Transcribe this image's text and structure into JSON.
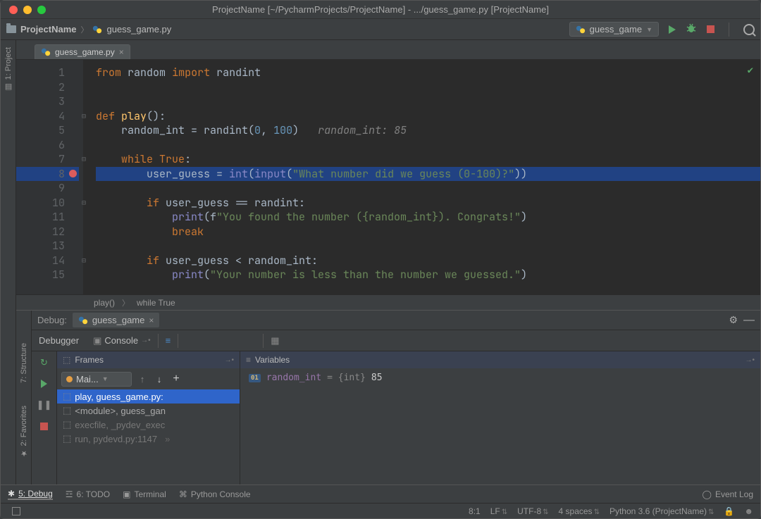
{
  "window": {
    "title": "ProjectName [~/PycharmProjects/ProjectName] - .../guess_game.py [ProjectName]"
  },
  "breadcrumb": {
    "project": "ProjectName",
    "file": "guess_game.py"
  },
  "run_config": {
    "label": "guess_game"
  },
  "left_tools": {
    "project": "1: Project",
    "structure": "7: Structure",
    "favorites": "2: Favorites"
  },
  "editor": {
    "tab_label": "guess_game.py",
    "lines": [
      "1",
      "2",
      "3",
      "4",
      "5",
      "6",
      "7",
      "8",
      "9",
      "10",
      "11",
      "12",
      "13",
      "14",
      "15"
    ],
    "breakpoint_line": "8",
    "inlay": "random_int: 85",
    "code": {
      "l1_from": "from",
      "l1_random": "random",
      "l1_import": "import",
      "l1_randint": "randint",
      "l4_def": "def",
      "l4_play": "play",
      "l5_var": "random_int",
      "l5_eq": " = randint(",
      "l5_n0": "0",
      "l5_c": ", ",
      "l5_n1": "100",
      "l5_close": ")",
      "l7_while": "while",
      "l7_true": "True",
      "l8_var": "user_guess",
      "l8_eq": " = ",
      "l8_int": "int",
      "l8_op": "(",
      "l8_input": "input",
      "l8_op2": "(",
      "l8_str": "\"What number did we guess (0-100)?\"",
      "l8_close": "))",
      "l10_if": "if",
      "l10_cond": " user_guess == randint:",
      "l11_print": "print",
      "l11_op": "(f",
      "l11_str": "\"You found the number ({random_int}). Congrats!\"",
      "l11_cl": ")",
      "l12_break": "break",
      "l14_if": "if",
      "l14_cond": " user_guess < random_int:",
      "l15_print": "print",
      "l15_op": "(",
      "l15_str": "\"Your number is less than the number we guessed.\"",
      "l15_cl": ")"
    },
    "context": {
      "fn": "play()",
      "loop": "while True"
    }
  },
  "debug": {
    "title": "Debug:",
    "session": "guess_game",
    "tabs": {
      "debugger": "Debugger",
      "console": "Console"
    },
    "panels": {
      "frames": "Frames",
      "variables": "Variables"
    },
    "thread": "Mai...",
    "frames": [
      "play, guess_game.py:",
      "<module>, guess_gan",
      "execfile, _pydev_exec",
      "run, pydevd.py:1147"
    ],
    "variable": {
      "name": "random_int",
      "type": "{int}",
      "value": "85"
    }
  },
  "bottom_tools": {
    "debug": "5: Debug",
    "todo": "6: TODO",
    "terminal": "Terminal",
    "python_console": "Python Console",
    "event_log": "Event Log"
  },
  "status": {
    "pos": "8:1",
    "line_sep": "LF",
    "encoding": "UTF-8",
    "indent": "4 spaces",
    "interpreter": "Python 3.6 (ProjectName)"
  }
}
